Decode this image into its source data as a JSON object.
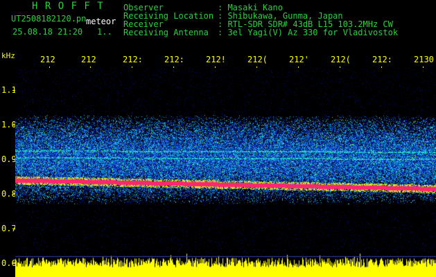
{
  "header": {
    "title": "H R O F F T",
    "filename": "UT2508182120.pn",
    "detector": "meteor",
    "datetime": "25.08.18 21:20",
    "index": "1..",
    "info_labels": [
      "Observer",
      "Receiving Location",
      "Receiver",
      "Receiving Antenna"
    ],
    "info_values": [
      ": Masaki Kano",
      ": Shibukawa, Gunma, Japan",
      ": RTL-SDR SDR# 43dB L15 103.2MHz CW",
      ": 3el Yagi(V) Az 330 for Vladivostok"
    ]
  },
  "chart_data": {
    "type": "heatmap",
    "ylabel": "kHz",
    "yticks": [
      "1.1",
      "1.0",
      "0.9",
      "0.8",
      "0.7",
      "0.6"
    ],
    "ylim": [
      0.58,
      1.14
    ],
    "xticks": [
      "212",
      "212",
      "212:",
      "212:",
      "212!",
      "212(",
      "212'",
      "212(",
      "212:",
      "2130"
    ],
    "features": {
      "carrier_khz_start": 0.84,
      "carrier_khz_end": 0.815,
      "faint_line_khz": [
        0.925,
        0.905
      ],
      "noise_band_khz": [
        0.8,
        1.0
      ],
      "bottom_spectrum": "yellow noise envelope"
    },
    "colors": {
      "text_green": "#28d23c",
      "text_white": "#ffffff",
      "axis_yellow": "#ffff00",
      "noise_blue": "#1a3ccc",
      "noise_cyan": "#20c8e0",
      "carrier_red": "#ff2a6a"
    }
  }
}
